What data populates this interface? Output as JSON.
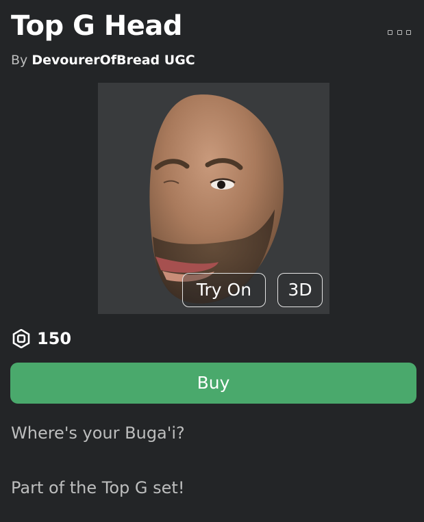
{
  "item": {
    "title": "Top G Head",
    "creator_prefix": "By",
    "creator_name": "DevourerOfBread UGC"
  },
  "thumbnail": {
    "try_on_label": "Try On",
    "view_3d_label": "3D"
  },
  "price": {
    "currency_icon": "robux-icon",
    "value": "150"
  },
  "buy_label": "Buy",
  "description": {
    "line_1": "Where's your Buga'i?",
    "line_2": "Part of the Top G set!"
  },
  "colors": {
    "background": "#232527",
    "thumbnail_bg": "#393b3d",
    "buy_button": "#4aa96c",
    "secondary_text": "#bdbebe"
  }
}
